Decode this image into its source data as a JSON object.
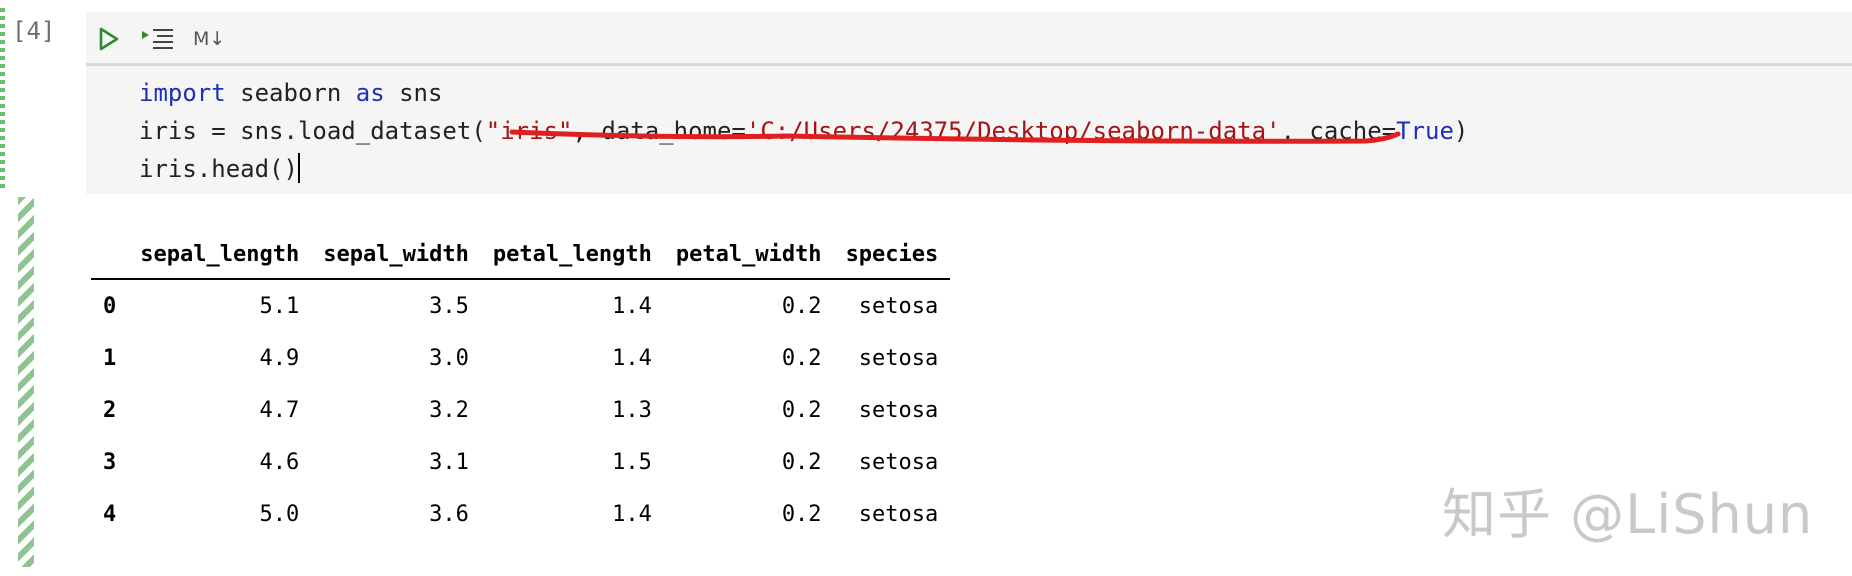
{
  "cell": {
    "execution_count": "[4]",
    "toolbar": {
      "run_icon": "play-triangle-icon",
      "run_below_icon": "run-cells-below-icon",
      "markdown_label": "M↓"
    },
    "code": {
      "line1": {
        "kw1": "import",
        "mid": " seaborn ",
        "kw2": "as",
        "tail": " sns"
      },
      "line2": {
        "pre": "iris = sns.load_dataset(",
        "str1": "\"iris\"",
        "mid1": ", data_home=",
        "str2": "'C:/Users/24375/Desktop/seaborn-data'",
        "mid2": ", cache=",
        "kw": "True",
        "tail": ")"
      },
      "line3": "iris.head()"
    },
    "annotation_color": "#e02020"
  },
  "output": {
    "columns": [
      "",
      "sepal_length",
      "sepal_width",
      "petal_length",
      "petal_width",
      "species"
    ],
    "rows": [
      [
        "0",
        "5.1",
        "3.5",
        "1.4",
        "0.2",
        "setosa"
      ],
      [
        "1",
        "4.9",
        "3.0",
        "1.4",
        "0.2",
        "setosa"
      ],
      [
        "2",
        "4.7",
        "3.2",
        "1.3",
        "0.2",
        "setosa"
      ],
      [
        "3",
        "4.6",
        "3.1",
        "1.5",
        "0.2",
        "setosa"
      ],
      [
        "4",
        "5.0",
        "3.6",
        "1.4",
        "0.2",
        "setosa"
      ]
    ]
  },
  "watermark": "知乎 @LiShun"
}
